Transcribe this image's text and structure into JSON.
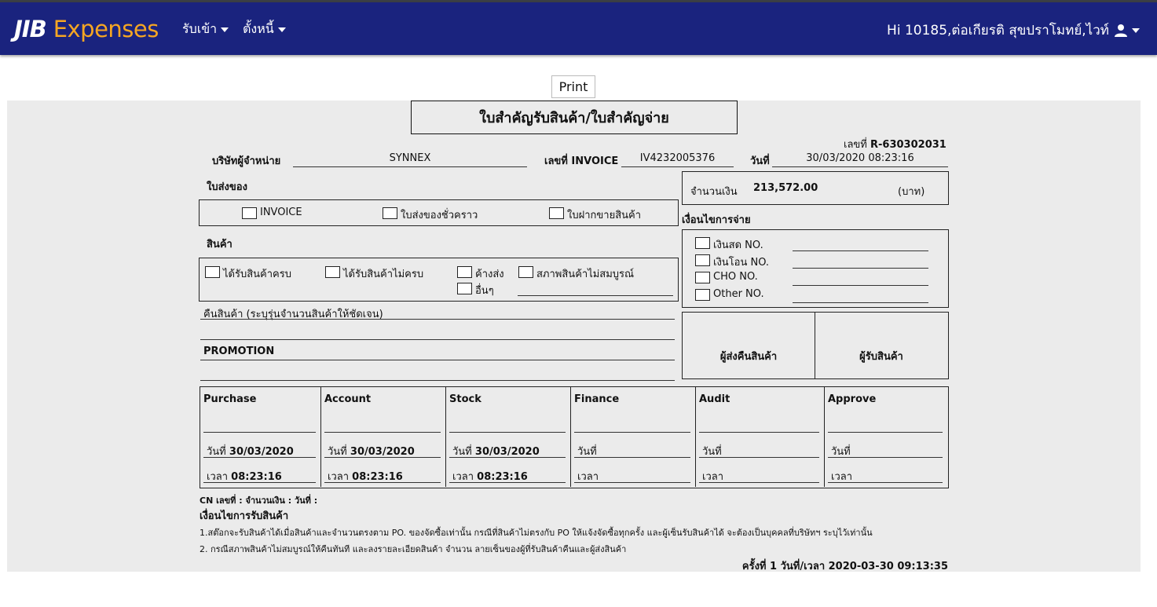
{
  "navbar": {
    "brand_jib": "JIB",
    "brand_expenses": "Expenses",
    "menu": [
      {
        "label": "รับเข้า"
      },
      {
        "label": "ตั้งหนี้"
      }
    ],
    "user_greeting": "Hi 10185,ต่อเกียรติ สุขปราโมทย์,ไวท์"
  },
  "print_label": "Print",
  "document": {
    "title": "ใบสำคัญรับสินค้า/ใบสำคัญจ่าย",
    "number_label": "เลขที่",
    "number_value": "R-630302031",
    "vendor_label": "บริษัทผู้จำหน่าย",
    "vendor_value": "SYNNEX",
    "invoice_label": "เลขที่ INVOICE",
    "invoice_value": "IV4232005376",
    "date_label": "วันที่",
    "date_value": "30/03/2020 08:23:16",
    "amount_label": "จำนวนเงิน",
    "amount_value": "213,572.00",
    "amount_unit": "(บาท)",
    "delivery_section": "ใบส่งของ",
    "delivery_options": [
      "INVOICE",
      "ใบส่งของชั่วคราว",
      "ใบฝากขายสินค้า"
    ],
    "payment_section": "เงื่อนไขการจ่าย",
    "payment_options": [
      "เงินสด NO.",
      "เงินโอน NO.",
      "CHO NO.",
      "Other NO."
    ],
    "goods_section": "สินค้า",
    "goods_options": [
      "ได้รับสินค้าครบ",
      "ได้รับสินค้าไม่ครบ",
      "ค้างส่ง",
      "สภาพสินค้าไม่สมบูรณ์",
      "อื่นๆ"
    ],
    "return_label": "คืนสินค้า (ระบุรุ่นจำนวนสินค้าให้ชัดเจน)",
    "promotion_label": "PROMOTION",
    "sender_return": "ผู้ส่งคืนสินค้า",
    "receiver": "ผู้รับสินค้า",
    "signatures": [
      {
        "title": "Purchase",
        "date_label": "วันที่",
        "date": "30/03/2020",
        "time_label": "เวลา",
        "time": "08:23:16"
      },
      {
        "title": "Account",
        "date_label": "วันที่",
        "date": "30/03/2020",
        "time_label": "เวลา",
        "time": "08:23:16"
      },
      {
        "title": "Stock",
        "date_label": "วันที่",
        "date": "30/03/2020",
        "time_label": "เวลา",
        "time": "08:23:16"
      },
      {
        "title": "Finance",
        "date_label": "วันที่",
        "date": "",
        "time_label": "เวลา",
        "time": ""
      },
      {
        "title": "Audit",
        "date_label": "วันที่",
        "date": "",
        "time_label": "เวลา",
        "time": ""
      },
      {
        "title": "Approve",
        "date_label": "วันที่",
        "date": "",
        "time_label": "เวลา",
        "time": ""
      }
    ],
    "cn_line": "CN เลขที่ : จำนวนเงิน : วันที่ :",
    "conditions_title": "เงื่อนไขการรับสินค้า",
    "condition_1": "1.สต๊อกจะรับสินค้าได้เมื่อสินค้าและจำนวนตรงตาม PO. ของจัดซื้อเท่านั้น กรณีที่สินค้าไม่ตรงกับ PO ให้แจ้งจัดซื้อทุกครั้ง และผู้เซ็นรับสินค้าได้ จะต้องเป็นบุคคลที่บริษัทฯ ระบุไว้เท่านั้น",
    "condition_2": "2. กรณีสภาพสินค้าไม่สมบูรณ์ให้คืนทันที และลงรายละเอียดสินค้า จำนวน ลายเซ็นของผู้ที่รับสินค้าคืนและผู้ส่งสินค้า",
    "print_count": "ครั้งที่ 1 วันที่/เวลา 2020-03-30 09:13:35"
  }
}
